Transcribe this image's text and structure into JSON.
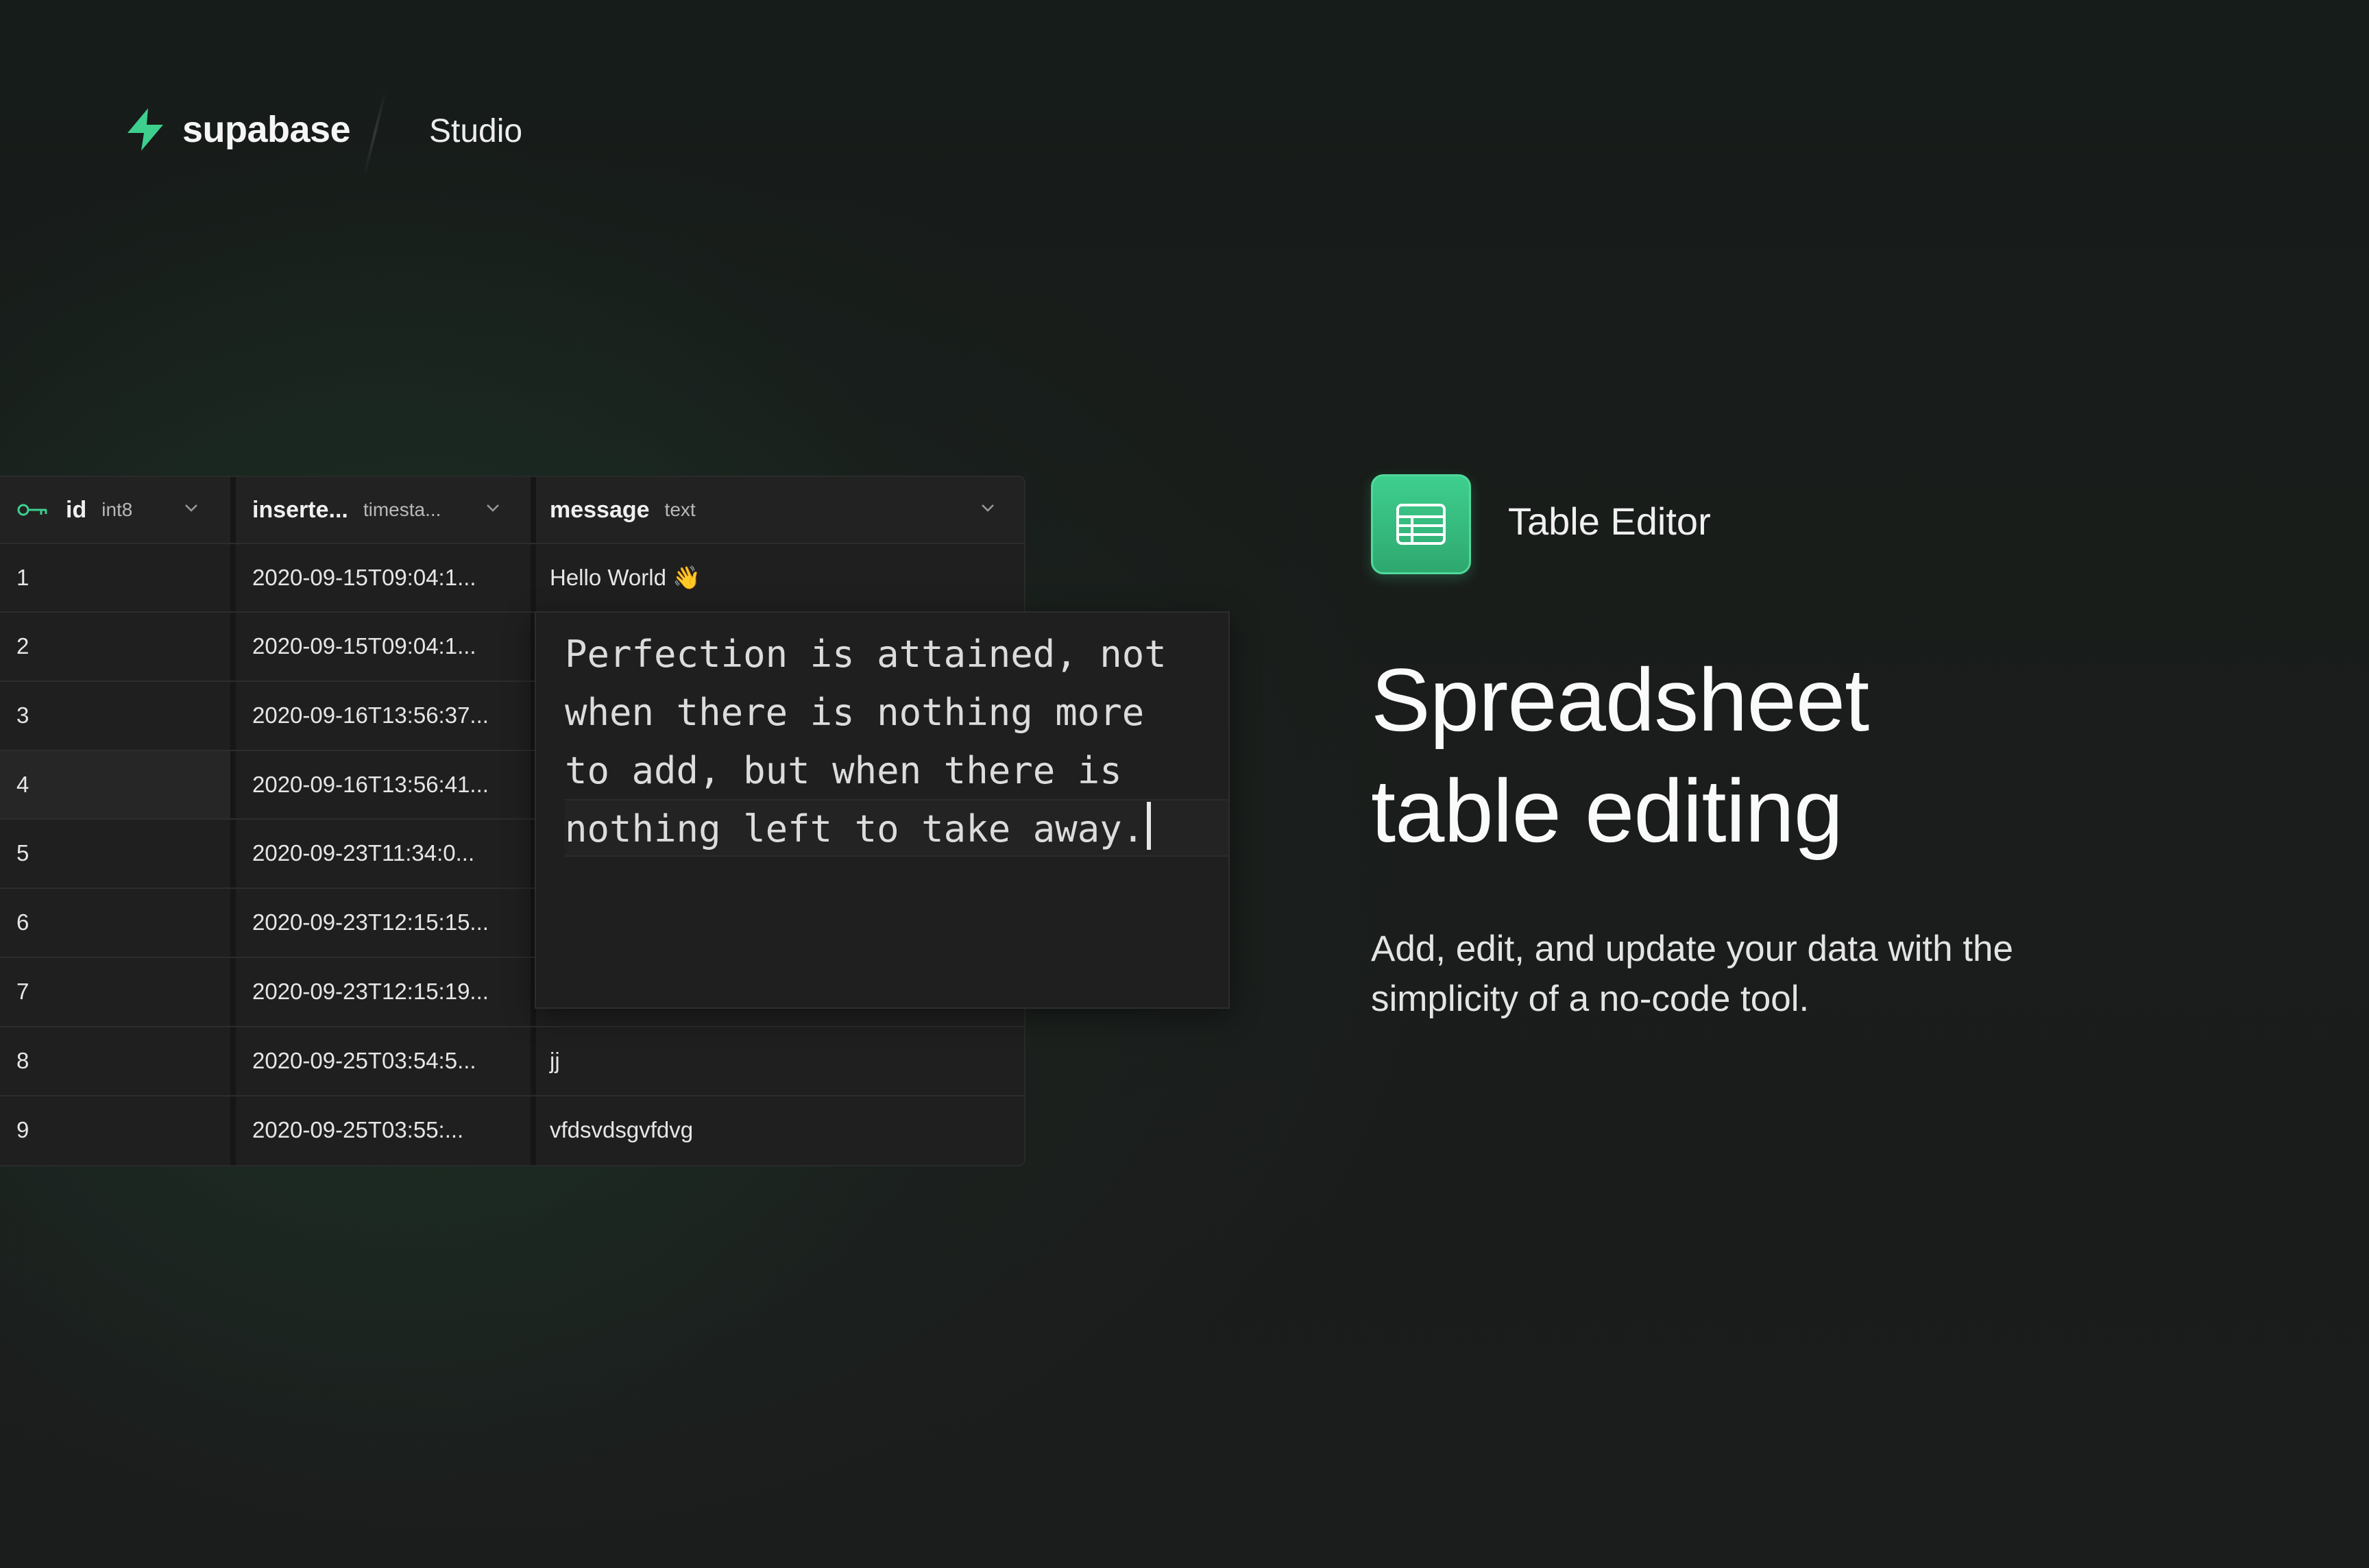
{
  "header": {
    "brand_name": "supabase",
    "product_name": "Studio",
    "logo_icon": "bolt-icon",
    "accent_color": "#3ECF8E"
  },
  "grid": {
    "columns": [
      {
        "name": "id",
        "type": "int8",
        "icon": "key-icon"
      },
      {
        "name": "inserte...",
        "type": "timesta..."
      },
      {
        "name": "message",
        "type": "text"
      }
    ],
    "rows": [
      {
        "id": "1",
        "inserted_at": "2020-09-15T09:04:1...",
        "message": "Hello World 👋"
      },
      {
        "id": "2",
        "inserted_at": "2020-09-15T09:04:1...",
        "message": ""
      },
      {
        "id": "3",
        "inserted_at": "2020-09-16T13:56:37...",
        "message": ""
      },
      {
        "id": "4",
        "inserted_at": "2020-09-16T13:56:41...",
        "message": ""
      },
      {
        "id": "5",
        "inserted_at": "2020-09-23T11:34:0...",
        "message": ""
      },
      {
        "id": "6",
        "inserted_at": "2020-09-23T12:15:15...",
        "message": ""
      },
      {
        "id": "7",
        "inserted_at": "2020-09-23T12:15:19...",
        "message": ""
      },
      {
        "id": "8",
        "inserted_at": "2020-09-25T03:54:5...",
        "message": "jj"
      },
      {
        "id": "9",
        "inserted_at": "2020-09-25T03:55:...",
        "message": "vfdsvdsgvfdvg"
      }
    ],
    "editor_lines": [
      "Perfection is attained, not",
      "when there is nothing more",
      "to add, but when there is",
      "nothing left to take away."
    ]
  },
  "feature": {
    "icon": "table-icon",
    "label": "Table Editor",
    "headline_line1": "Spreadsheet",
    "headline_line2": "table editing",
    "description": "Add, edit, and update your data with the simplicity of a no-code tool."
  }
}
